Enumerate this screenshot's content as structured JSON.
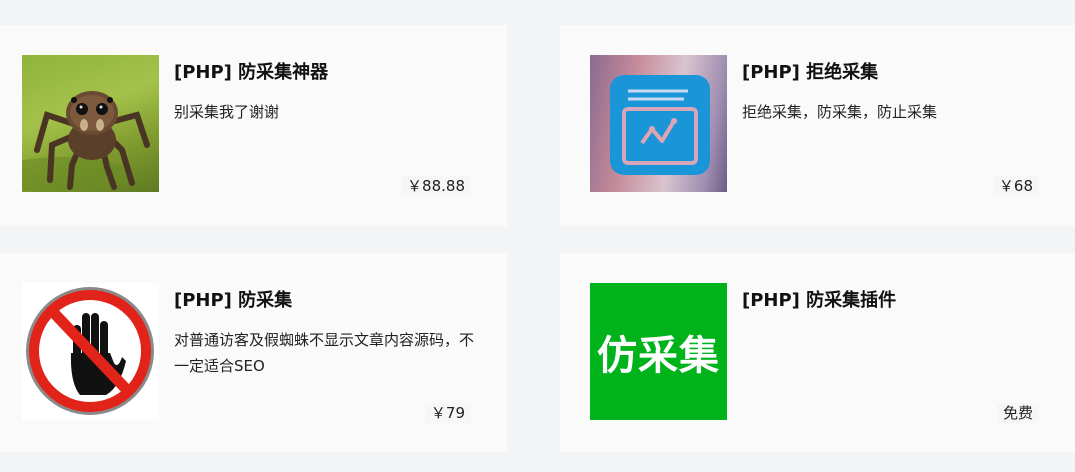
{
  "products": [
    {
      "title": "[PHP] 防采集神器",
      "description": "别采集我了谢谢",
      "price": "￥88.88",
      "thumbnail_icon": "jumping-spider-photo"
    },
    {
      "title": "[PHP] 拒绝采集",
      "description": "拒绝采集，防采集，防止采集",
      "price": "￥68",
      "thumbnail_icon": "blue-app-window-icon"
    },
    {
      "title": "[PHP] 防采集",
      "description": "对普通访客及假蜘蛛不显示文章内容源码，不一定适合SEO",
      "price": "￥79",
      "thumbnail_icon": "stop-hand-sign"
    },
    {
      "title": "[PHP] 防采集插件",
      "description": "",
      "price": "免费",
      "thumbnail_text": "仿采集",
      "thumbnail_icon": "green-text-logo"
    }
  ],
  "colors": {
    "page_background": "#f3f4f6",
    "card_background": "#fafafb",
    "app_icon_blue": "#1a96d8",
    "stop_red": "#e2231a",
    "green_logo": "#00b31a"
  }
}
